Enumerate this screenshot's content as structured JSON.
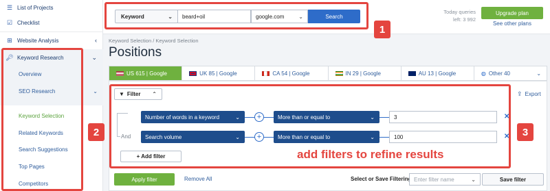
{
  "sidebar": {
    "list_of_projects": "List of Projects",
    "checklist": "Checklist",
    "website_analysis": "Website Analysis",
    "keyword_research": "Keyword Research",
    "overview": "Overview",
    "seo_research": "SEO Research",
    "keyword_selection": "Keyword Selection",
    "related_keywords": "Related Keywords",
    "search_suggestions": "Search Suggestions",
    "top_pages": "Top Pages",
    "competitors": "Competitors"
  },
  "search": {
    "type": "Keyword",
    "query": "beard+oil",
    "database": "google.com",
    "button": "Search"
  },
  "account": {
    "queries_line1": "Today queries",
    "queries_line2": "left: 3 992",
    "upgrade": "Upgrade plan",
    "other_plans": "See other plans"
  },
  "breadcrumb": "Keyword Selection / Keyword Selection",
  "page_title": "Positions",
  "tabs": [
    {
      "label": "US 615 | Google",
      "flag": "us"
    },
    {
      "label": "UK 85 | Google",
      "flag": "uk"
    },
    {
      "label": "CA 54 | Google",
      "flag": "ca"
    },
    {
      "label": "IN 29 | Google",
      "flag": "in"
    },
    {
      "label": "AU 13 | Google",
      "flag": "au"
    },
    {
      "label": "Other 40",
      "flag": "globe"
    }
  ],
  "filter_button": "Filter",
  "export": "Export",
  "and_label": "And",
  "filters": [
    {
      "field": "Number of words in a keyword",
      "operator": "More than or equal to",
      "value": "3"
    },
    {
      "field": "Search volume",
      "operator": "More than or equal to",
      "value": "100"
    }
  ],
  "add_filter": "+ Add filter",
  "annotation": "add filters to refine results",
  "markers": [
    "1",
    "2",
    "3"
  ],
  "footer": {
    "apply": "Apply filter",
    "remove_all": "Remove All",
    "select_save": "Select or Save Filtering:",
    "filter_name_placeholder": "Enter filter name",
    "save": "Save filter"
  },
  "colors": {
    "accent_green": "#6fb13f",
    "primary_blue": "#2e6cc9",
    "dark_blue": "#1e4d8c",
    "annotation_red": "#e4453f"
  }
}
